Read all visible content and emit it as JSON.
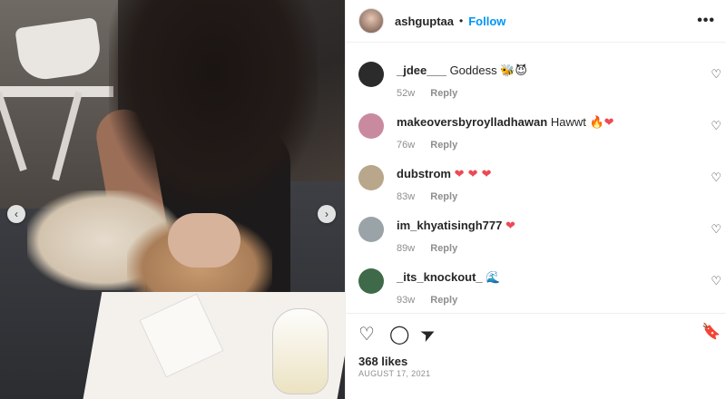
{
  "header": {
    "username": "ashguptaa",
    "dot": "•",
    "follow_label": "Follow",
    "more_icon": "more-horizontal-icon"
  },
  "carousel": {
    "prev_glyph": "‹",
    "next_glyph": "›"
  },
  "comments": [
    {
      "user": "_jdee___",
      "text": "Goddess",
      "emoji": "🐝😈",
      "age": "52w",
      "reply": "Reply",
      "avatar_color": "#2b2b2b"
    },
    {
      "user": "makeoversbyroylladhawan",
      "text": "Hawwt",
      "emoji": "🔥❤",
      "age": "76w",
      "reply": "Reply",
      "avatar_color": "#c98aa0"
    },
    {
      "user": "dubstrom",
      "text": "",
      "emoji": "❤ ❤ ❤",
      "age": "83w",
      "reply": "Reply",
      "avatar_color": "#b8a78a"
    },
    {
      "user": "im_khyatisingh777",
      "text": "",
      "emoji": "❤",
      "age": "89w",
      "reply": "Reply",
      "avatar_color": "#9aa3a8"
    },
    {
      "user": "_its_knockout_",
      "text": "",
      "emoji": "🌊",
      "age": "93w",
      "reply": "Reply",
      "avatar_color": "#3f6a4a"
    }
  ],
  "actions": {
    "like_glyph": "♡",
    "comment_glyph": "◯",
    "share_glyph": "➤",
    "save_glyph": "🔖"
  },
  "likes": "368 likes",
  "date": "AUGUST 17, 2021",
  "colors": {
    "follow": "#0095f6",
    "heart": "#ed4956",
    "meta": "#8e8e8e"
  }
}
